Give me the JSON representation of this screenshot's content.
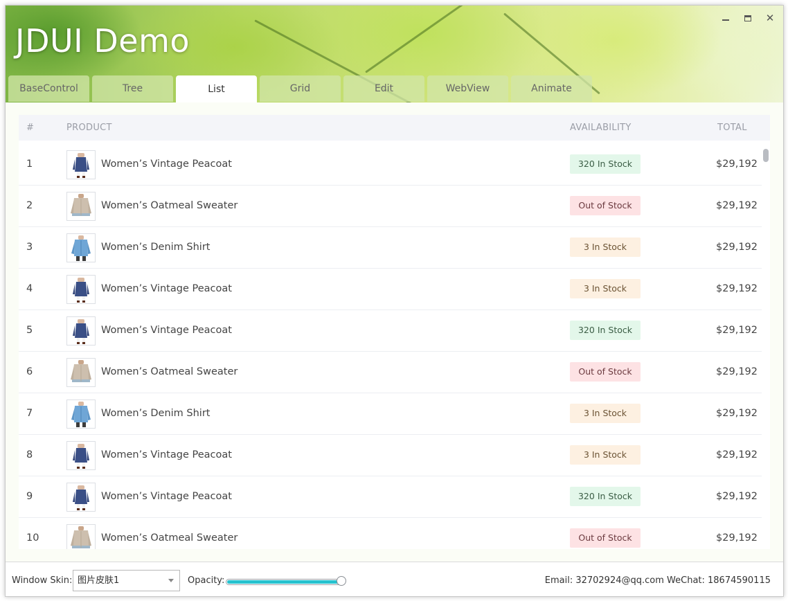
{
  "window": {
    "title": "JDUI Demo",
    "controls": {
      "minimize": "minimize-icon",
      "maximize": "maximize-icon",
      "close": "close-icon"
    }
  },
  "tabs": [
    {
      "label": "BaseControl",
      "active": false
    },
    {
      "label": "Tree",
      "active": false
    },
    {
      "label": "List",
      "active": true
    },
    {
      "label": "Grid",
      "active": false
    },
    {
      "label": "Edit",
      "active": false
    },
    {
      "label": "WebView",
      "active": false
    },
    {
      "label": "Animate",
      "active": false
    }
  ],
  "table": {
    "headers": {
      "num": "#",
      "product": "PRODUCT",
      "availability": "AVAILABILITY",
      "total": "TOTAL"
    },
    "rows": [
      {
        "num": "1",
        "product": "Women’s Vintage Peacoat",
        "image": "peacoat",
        "availability": "320 In Stock",
        "status": "green",
        "total": "$29,192"
      },
      {
        "num": "2",
        "product": "Women’s Oatmeal Sweater",
        "image": "sweater",
        "availability": "Out of Stock",
        "status": "red",
        "total": "$29,192"
      },
      {
        "num": "3",
        "product": "Women’s Denim Shirt",
        "image": "denim",
        "availability": "3 In Stock",
        "status": "orange",
        "total": "$29,192"
      },
      {
        "num": "4",
        "product": "Women’s Vintage Peacoat",
        "image": "peacoat",
        "availability": "3 In Stock",
        "status": "orange",
        "total": "$29,192"
      },
      {
        "num": "5",
        "product": "Women’s Vintage Peacoat",
        "image": "peacoat",
        "availability": "320 In Stock",
        "status": "green",
        "total": "$29,192"
      },
      {
        "num": "6",
        "product": "Women’s Oatmeal Sweater",
        "image": "sweater",
        "availability": "Out of Stock",
        "status": "red",
        "total": "$29,192"
      },
      {
        "num": "7",
        "product": "Women’s Denim Shirt",
        "image": "denim",
        "availability": "3 In Stock",
        "status": "orange",
        "total": "$29,192"
      },
      {
        "num": "8",
        "product": "Women’s Vintage Peacoat",
        "image": "peacoat",
        "availability": "3 In Stock",
        "status": "orange",
        "total": "$29,192"
      },
      {
        "num": "9",
        "product": "Women’s Vintage Peacoat",
        "image": "peacoat",
        "availability": "320 In Stock",
        "status": "green",
        "total": "$29,192"
      },
      {
        "num": "10",
        "product": "Women’s Oatmeal Sweater",
        "image": "sweater",
        "availability": "Out of Stock",
        "status": "red",
        "total": "$29,192"
      }
    ]
  },
  "footer": {
    "skin_label": "Window Skin:",
    "skin_value": "图片皮肤1",
    "opacity_label": "Opacity:",
    "opacity_value": 0.97,
    "contact": "Email: 32702924@qq.com WeChat: 18674590115"
  },
  "colors": {
    "accent": "#27c2cf",
    "badge_green": "#e3f7ea",
    "badge_red": "#fde2e4",
    "badge_orange": "#fdf0e1"
  }
}
